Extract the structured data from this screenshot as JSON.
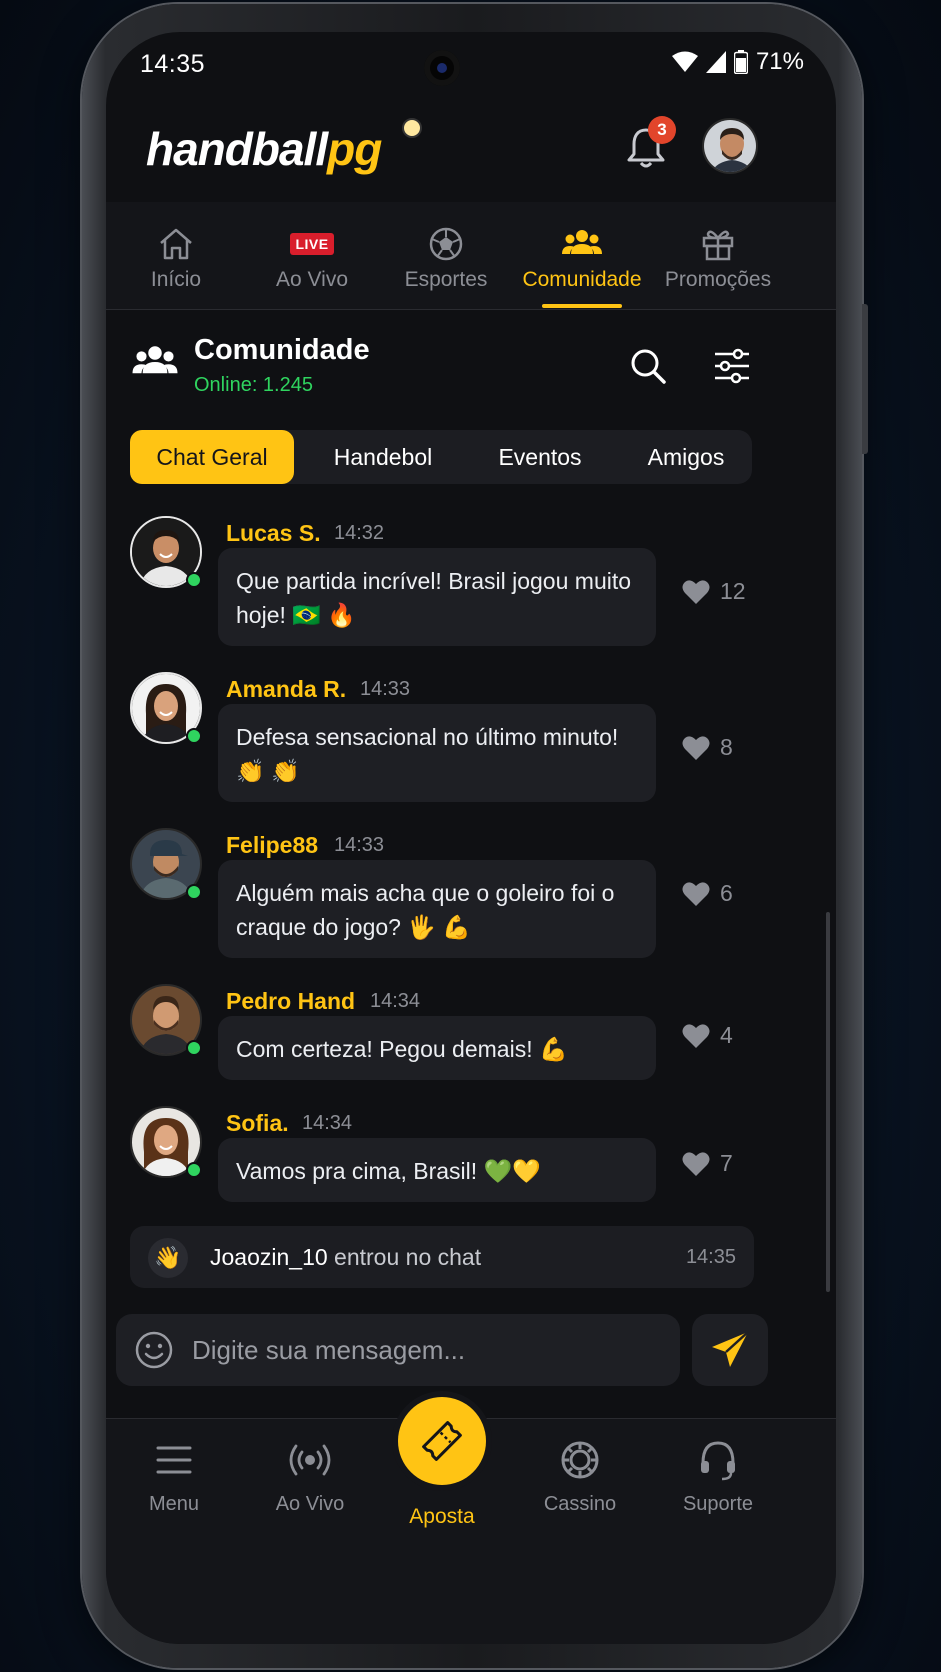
{
  "status_bar": {
    "time": "14:35",
    "battery": "71%"
  },
  "header": {
    "logo_main": "handball",
    "logo_accent": "pg",
    "notification_count": "3"
  },
  "top_nav": [
    {
      "label": "Início",
      "icon": "home-icon",
      "active": false
    },
    {
      "label": "Ao Vivo",
      "icon": "live-badge",
      "badge": "LIVE",
      "active": false
    },
    {
      "label": "Esportes",
      "icon": "soccer-ball-icon",
      "active": false
    },
    {
      "label": "Comunidade",
      "icon": "users-icon",
      "active": true
    },
    {
      "label": "Promoções",
      "icon": "gift-icon",
      "active": false
    }
  ],
  "community": {
    "title": "Comunidade",
    "online": "Online: 1.245"
  },
  "tabs": [
    {
      "label": "Chat Geral",
      "active": true
    },
    {
      "label": "Handebol",
      "active": false
    },
    {
      "label": "Eventos",
      "active": false
    },
    {
      "label": "Amigos",
      "active": false
    }
  ],
  "messages": [
    {
      "name": "Lucas S.",
      "time": "14:32",
      "text": "Que partida incrível! Brasil jogou muito hoje! 🇧🇷 🔥",
      "likes": "12"
    },
    {
      "name": "Amanda R.",
      "time": "14:33",
      "text": "Defesa sensacional no último minuto! 👏 👏",
      "likes": "8"
    },
    {
      "name": "Felipe88",
      "time": "14:33",
      "text": "Alguém mais acha que o goleiro foi o craque do jogo? 🖐 💪",
      "likes": "6"
    },
    {
      "name": "Pedro Hand",
      "time": "14:34",
      "text": "Com certeza! Pegou demais! 💪",
      "likes": "4"
    },
    {
      "name": "Sofia.",
      "time": "14:34",
      "text": "Vamos pra cima, Brasil! 💚💛",
      "likes": "7"
    }
  ],
  "join_notice": {
    "emoji": "👋",
    "user": "Joaozin_10",
    "text": " entrou no chat",
    "time": "14:35"
  },
  "composer": {
    "placeholder": "Digite sua mensagem..."
  },
  "bottom_nav": [
    {
      "label": "Menu",
      "icon": "menu-icon"
    },
    {
      "label": "Ao Vivo",
      "icon": "broadcast-icon"
    },
    {
      "label": "Aposta",
      "icon": "ticket-icon",
      "active": true
    },
    {
      "label": "Cassino",
      "icon": "casino-chip-icon"
    },
    {
      "label": "Suporte",
      "icon": "headset-icon"
    }
  ],
  "colors": {
    "accent": "#ffc414",
    "online": "#2fd45f",
    "background": "#0f1013",
    "surface": "#1e1f24",
    "live": "#d91e2c",
    "badge": "#e2452b"
  }
}
